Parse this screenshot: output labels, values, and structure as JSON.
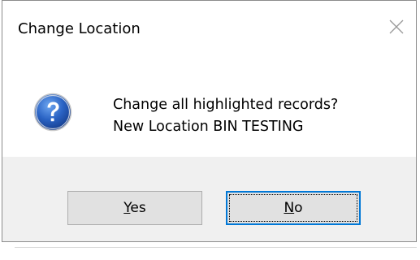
{
  "window": {
    "title": "Change Location"
  },
  "icons": {
    "close": "close-icon",
    "question": "question-icon"
  },
  "message": {
    "line1": "Change all highlighted records?",
    "line2": "New Location BIN TESTING"
  },
  "buttons": {
    "yes": {
      "accel": "Y",
      "rest": "es"
    },
    "no": {
      "accel": "N",
      "rest": "o"
    },
    "default": "no"
  },
  "colors": {
    "footer_bg": "#f0f0f0",
    "button_bg": "#e1e1e1",
    "button_border": "#adadad",
    "default_border": "#0078d7",
    "icon_blue": "#1f5fbf"
  }
}
